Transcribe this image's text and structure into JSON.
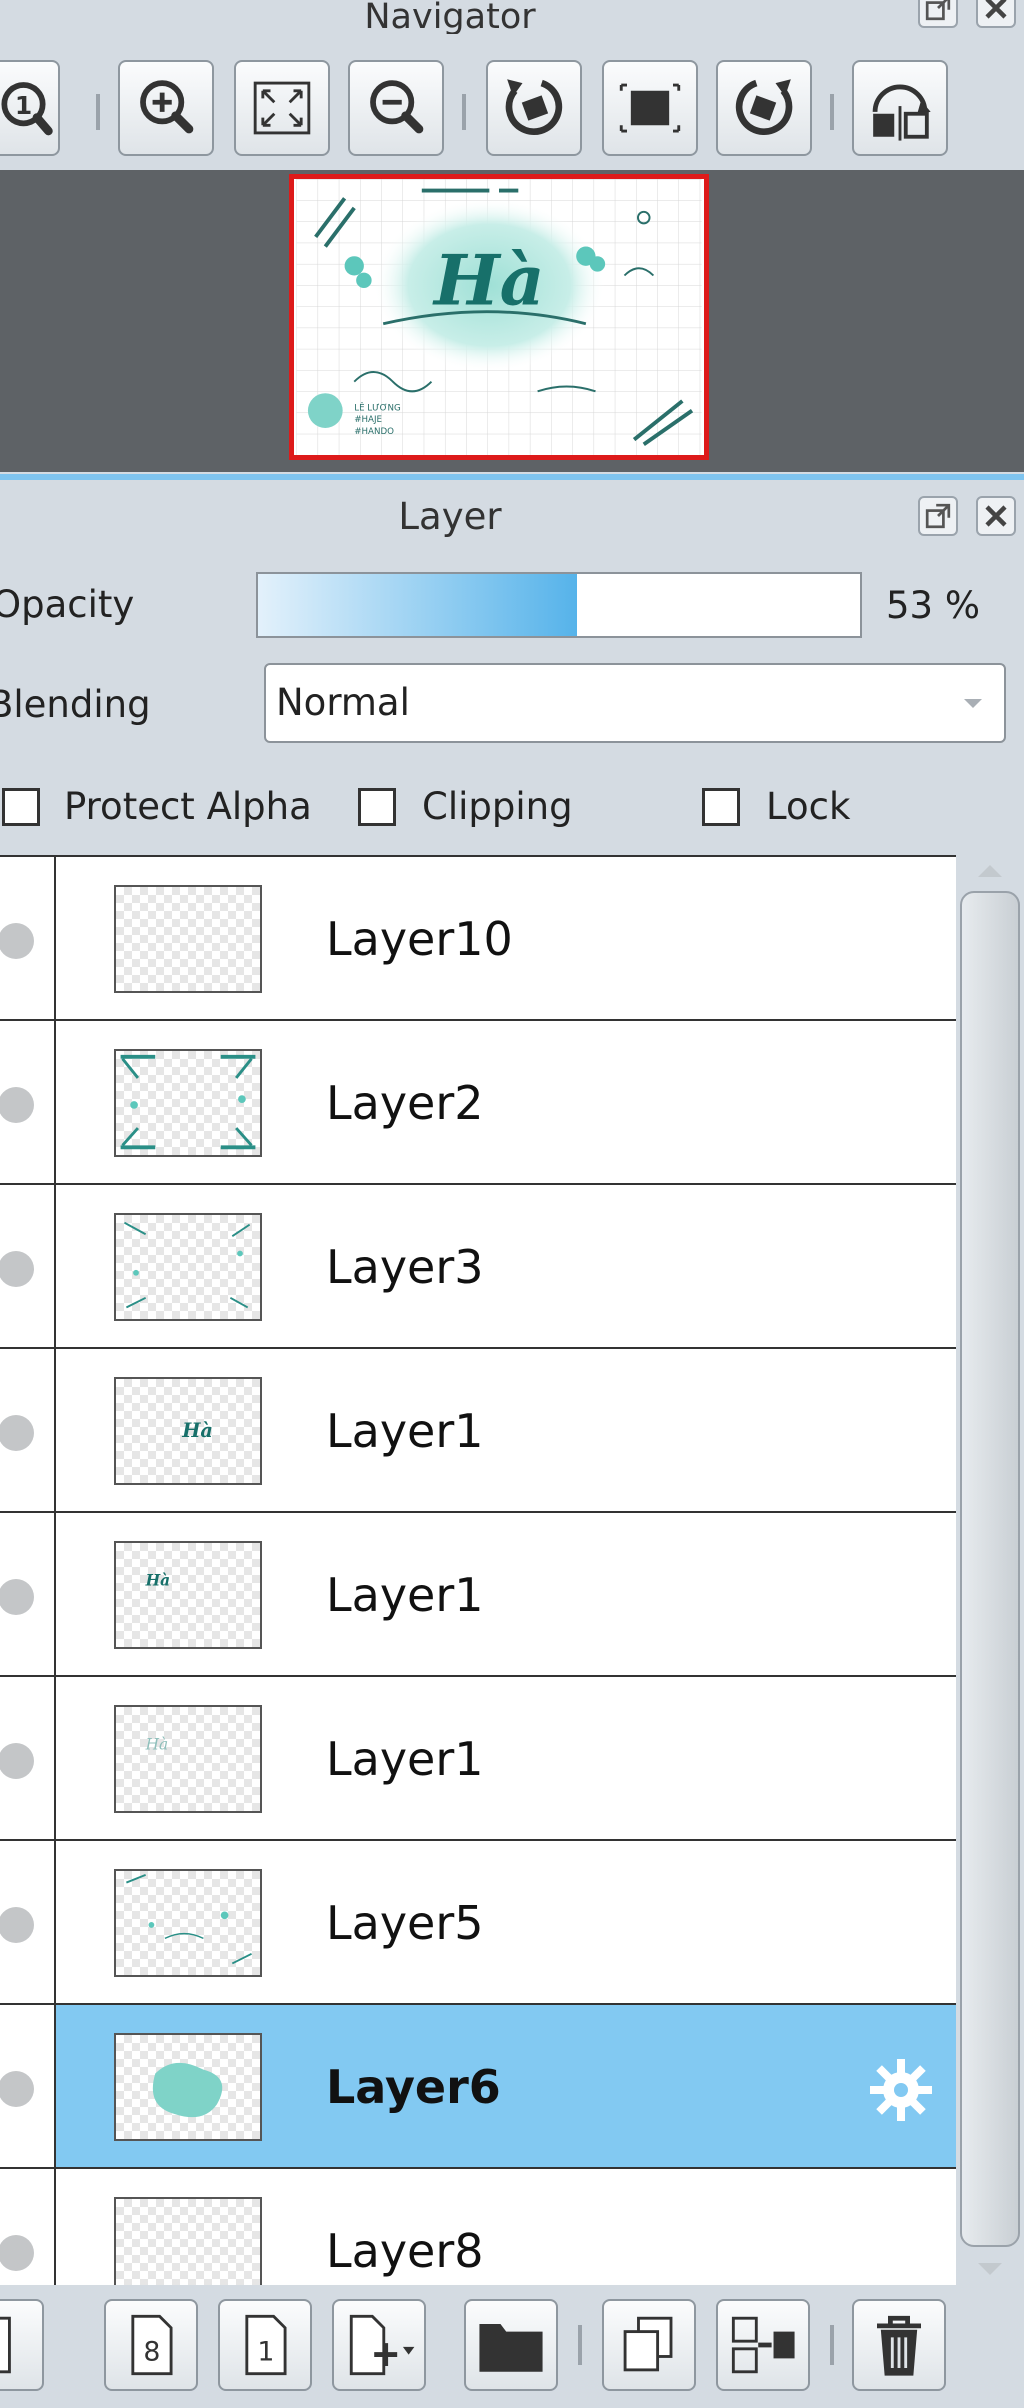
{
  "navigator": {
    "title": "Navigator",
    "toolbar": [
      {
        "name": "zoom-actual-button",
        "icon": "magnifier-one-icon"
      },
      {
        "name": "zoom-in-button",
        "icon": "zoom-in-icon"
      },
      {
        "name": "fit-window-button",
        "icon": "fit-screen-icon"
      },
      {
        "name": "zoom-out-button",
        "icon": "zoom-out-icon"
      },
      {
        "name": "rotate-left-button",
        "icon": "rotate-left-icon"
      },
      {
        "name": "reset-rotation-button",
        "icon": "reset-rotation-icon"
      },
      {
        "name": "rotate-right-button",
        "icon": "rotate-right-icon"
      },
      {
        "name": "flip-horizontal-button",
        "icon": "flip-horizontal-icon"
      }
    ],
    "preview": {
      "text": "Hà",
      "small_lines": [
        "LÊ LƯƠNG",
        "#HAJE",
        "#HANDO"
      ]
    }
  },
  "layer_panel": {
    "title": "Layer",
    "opacity_label": "Opacity",
    "opacity_percent": 53,
    "opacity_text": "53 %",
    "blending_label": "Blending",
    "blending_value": "Normal",
    "protect_alpha_label": "Protect Alpha",
    "protect_alpha_checked": false,
    "clipping_label": "Clipping",
    "clipping_checked": false,
    "lock_label": "Lock",
    "lock_checked": false,
    "layers": [
      {
        "name": "Layer10",
        "selected": false,
        "thumb": "empty"
      },
      {
        "name": "Layer2",
        "selected": false,
        "thumb": "frame-dense"
      },
      {
        "name": "Layer3",
        "selected": false,
        "thumb": "frame-light"
      },
      {
        "name": "Layer1",
        "selected": false,
        "thumb": "text-ha"
      },
      {
        "name": "Layer1",
        "selected": false,
        "thumb": "text-ha-small"
      },
      {
        "name": "Layer1",
        "selected": false,
        "thumb": "text-ha-faint"
      },
      {
        "name": "Layer5",
        "selected": false,
        "thumb": "doodles"
      },
      {
        "name": "Layer6",
        "selected": true,
        "thumb": "watercolor-blob"
      },
      {
        "name": "Layer8",
        "selected": false,
        "thumb": "empty"
      }
    ],
    "bottom_toolbar": [
      {
        "name": "new-layer-button",
        "icon": "new-page-icon"
      },
      {
        "name": "new-8bit-layer-button",
        "icon": "page-8-icon"
      },
      {
        "name": "new-1bit-layer-button",
        "icon": "page-1-icon"
      },
      {
        "name": "add-layer-menu-button",
        "icon": "add-page-dropdown-icon"
      },
      {
        "name": "new-folder-button",
        "icon": "folder-icon"
      },
      {
        "name": "duplicate-layer-button",
        "icon": "duplicate-icon"
      },
      {
        "name": "merge-layer-button",
        "icon": "merge-icon"
      },
      {
        "name": "delete-layer-button",
        "icon": "trash-icon"
      }
    ]
  },
  "colors": {
    "panel_bg": "#d4dbe2",
    "selection": "#82c9f2",
    "preview_border": "#dd1a1a",
    "accent_teal": "#2a8f87"
  }
}
